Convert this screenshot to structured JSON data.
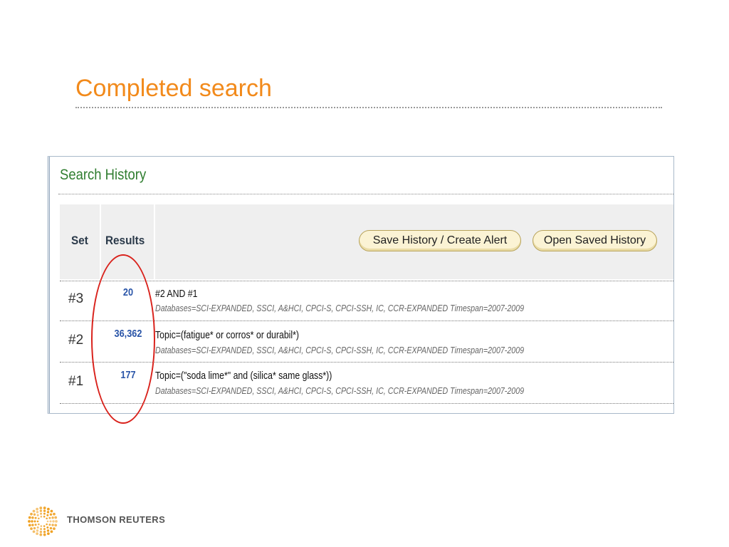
{
  "slide": {
    "title": "Completed search"
  },
  "search_history": {
    "title": "Search History",
    "columns": {
      "set": "Set",
      "results": "Results"
    },
    "buttons": {
      "save_history": "Save History / Create Alert",
      "open_saved": "Open Saved History"
    },
    "rows": [
      {
        "set": "#3",
        "results": "20",
        "query": "#2 AND #1",
        "databases": "Databases=SCI-EXPANDED, SSCI, A&HCI, CPCI-S, CPCI-SSH, IC, CCR-EXPANDED Timespan=2007-2009"
      },
      {
        "set": "#2",
        "results": "36,362",
        "query": "Topic=(fatigue* or corros* or durabil*)",
        "databases": "Databases=SCI-EXPANDED, SSCI, A&HCI, CPCI-S, CPCI-SSH, IC, CCR-EXPANDED Timespan=2007-2009"
      },
      {
        "set": "#1",
        "results": "177",
        "query": "Topic=(\"soda lime*\" and (silica* same glass*))",
        "databases": "Databases=SCI-EXPANDED, SSCI, A&HCI, CPCI-S, CPCI-SSH, IC, CCR-EXPANDED Timespan=2007-2009"
      }
    ]
  },
  "footer": {
    "logo_text": "THOMSON REUTERS"
  },
  "colors": {
    "title": "#f28a1b",
    "heading_green": "#2f7d2f",
    "result_blue": "#2a55a8",
    "highlight_red": "#d9221c",
    "logo_orange": "#f0a020"
  }
}
